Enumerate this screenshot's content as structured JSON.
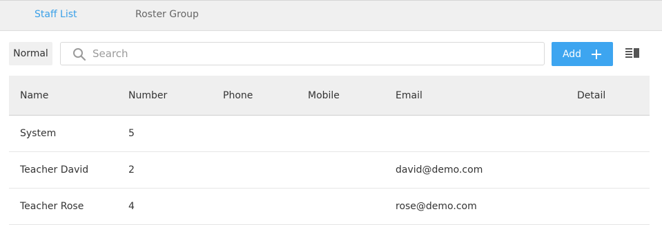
{
  "tabs": [
    {
      "label": "Staff List",
      "active": true
    },
    {
      "label": "Roster Group",
      "active": false
    }
  ],
  "toolbar": {
    "mode_label": "Normal",
    "search_placeholder": "Search",
    "search_value": "",
    "add_label": "Add",
    "icons": {
      "search": "search-icon",
      "add": "plus-icon",
      "columns": "columns-icon"
    }
  },
  "table": {
    "headers": [
      "Name",
      "Number",
      "Phone",
      "Mobile",
      "Email",
      "Detail"
    ],
    "rows": [
      {
        "name": "System",
        "number": "5",
        "phone": "",
        "mobile": "",
        "email": "",
        "detail": ""
      },
      {
        "name": "Teacher David",
        "number": "2",
        "phone": "",
        "mobile": "",
        "email": "david@demo.com",
        "detail": ""
      },
      {
        "name": "Teacher Rose",
        "number": "4",
        "phone": "",
        "mobile": "",
        "email": "rose@demo.com",
        "detail": ""
      }
    ]
  },
  "colors": {
    "accent": "#3da5f0",
    "active_tab": "#3aa0e8",
    "header_bg": "#efefef"
  }
}
